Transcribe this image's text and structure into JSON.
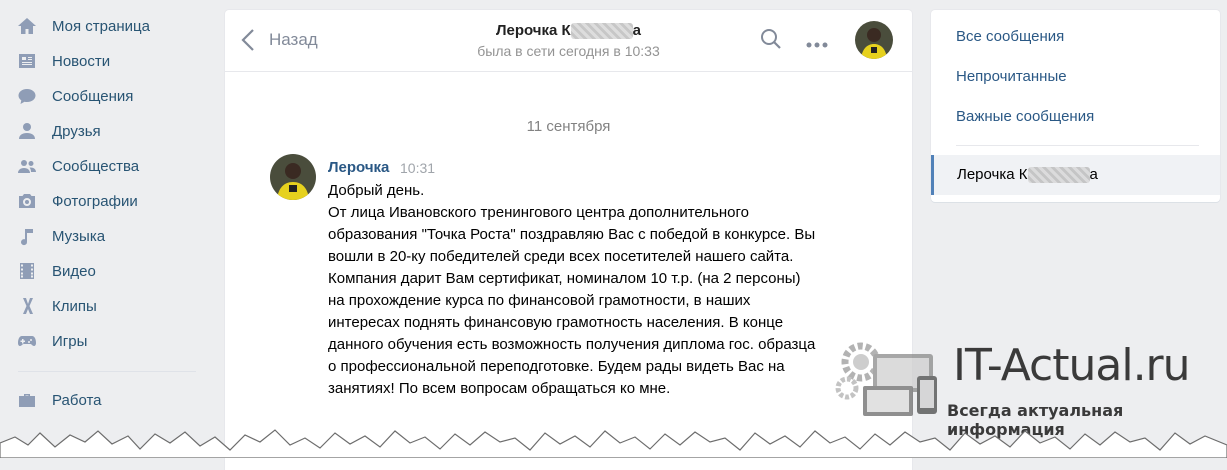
{
  "nav": {
    "items": [
      {
        "label": "Моя страница",
        "icon": "home-icon"
      },
      {
        "label": "Новости",
        "icon": "news-icon"
      },
      {
        "label": "Сообщения",
        "icon": "messages-icon"
      },
      {
        "label": "Друзья",
        "icon": "friend-icon"
      },
      {
        "label": "Сообщества",
        "icon": "communities-icon"
      },
      {
        "label": "Фотографии",
        "icon": "camera-icon"
      },
      {
        "label": "Музыка",
        "icon": "music-note-icon"
      },
      {
        "label": "Видео",
        "icon": "film-icon"
      },
      {
        "label": "Клипы",
        "icon": "clips-icon"
      },
      {
        "label": "Игры",
        "icon": "gamepad-icon"
      }
    ],
    "work": {
      "label": "Работа",
      "icon": "briefcase-icon"
    }
  },
  "header": {
    "back_label": "Назад",
    "peer_name_visible_start": "Лерочка К",
    "peer_name_visible_end": "а",
    "status": "была в сети сегодня в 10:33"
  },
  "chat": {
    "date": "11 сентября",
    "message": {
      "author": "Лерочка",
      "time": "10:31",
      "text": "Добрый день.\nОт лица Ивановского тренингового центра дополнительного образования \"Точка Роста\" поздравляю Вас с победой в конкурсе. Вы вошли в 20-ку победителей среди всех посетителей нашего сайта. Компания дарит Вам сертификат, номиналом 10 т.р. (на 2 персоны) на прохождение курса по финансовой грамотности, в наших интересах поднять финансовую грамотность населения. В конце данного обучения есть возможность получения диплома гос. образца о профессиональной переподготовке. Будем рады видеть Вас на занятиях! По всем вопросам обращаться ко мне."
    }
  },
  "side": {
    "all": "Все сообщения",
    "unread": "Непрочитанные",
    "important": "Важные сообщения",
    "active_start": "Лерочка К",
    "active_end": "а"
  },
  "watermark": {
    "title": "IT-Actual.ru",
    "subtitle": "Всегда актуальная информация"
  },
  "colors": {
    "accent": "#2a5885",
    "nav_icon": "#8f9db6",
    "background": "#edeef0"
  }
}
